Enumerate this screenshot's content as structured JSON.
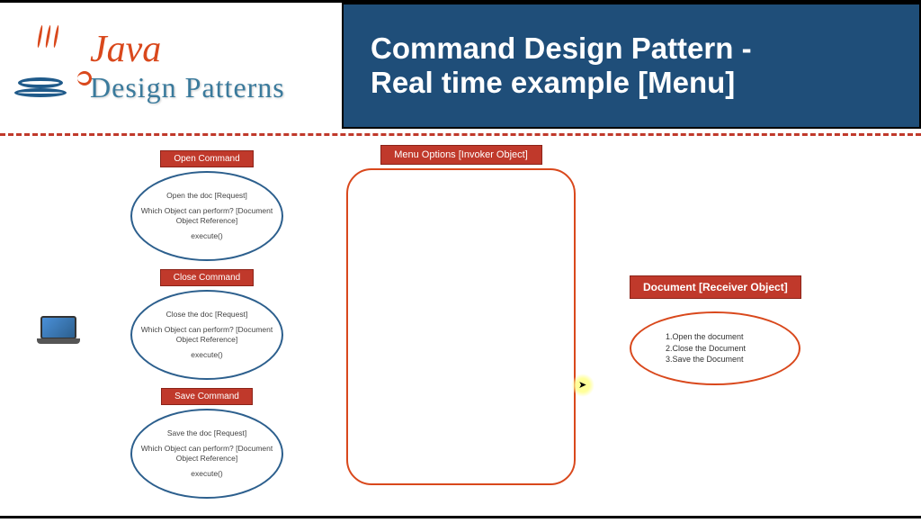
{
  "header": {
    "logo_main": "Java",
    "logo_sub": "Design Patterns",
    "title_line1": "Command Design Pattern -",
    "title_line2": "Real time example [Menu]"
  },
  "commands": [
    {
      "label": "Open Command",
      "request": "Open the doc [Request]",
      "perform": "Which Object can perform? [Document Object Reference]",
      "exec": "execute()"
    },
    {
      "label": "Close Command",
      "request": "Close the doc [Request]",
      "perform": "Which Object can perform? [Document Object Reference]",
      "exec": "execute()"
    },
    {
      "label": "Save Command",
      "request": "Save the doc [Request]",
      "perform": "Which Object can perform? [Document Object Reference]",
      "exec": "execute()"
    }
  ],
  "invoker": {
    "label": "Menu Options [Invoker Object]"
  },
  "receiver": {
    "label": "Document [Receiver Object]",
    "items": {
      "i1": "1.Open the document",
      "i2": "2.Close the Document",
      "i3": "3.Save the Document"
    }
  }
}
